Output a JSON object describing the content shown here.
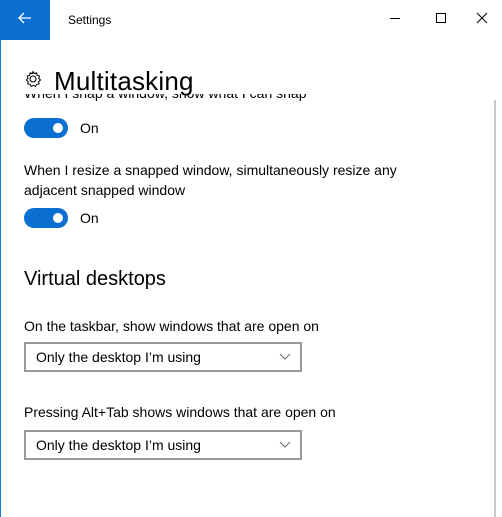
{
  "window": {
    "app_title": "Settings",
    "back_icon": "back-arrow-icon",
    "accent": "#0b6fd1"
  },
  "page": {
    "title": "Multitasking",
    "title_icon": "gear-icon"
  },
  "snap": {
    "clipped_setting_text": "When I snap a window, show what I can snap next to it",
    "toggle1": {
      "state": "On"
    },
    "resize_desc": "When I resize a snapped window, simultaneously resize any adjacent snapped window",
    "toggle2": {
      "state": "On"
    }
  },
  "virtual_desktops": {
    "title": "Virtual desktops",
    "taskbar_label": "On the taskbar, show windows that are open on",
    "taskbar_value": "Only the desktop I’m using",
    "alttab_label": "Pressing Alt+Tab shows windows that are open on",
    "alttab_value": "Only the desktop I’m using"
  }
}
